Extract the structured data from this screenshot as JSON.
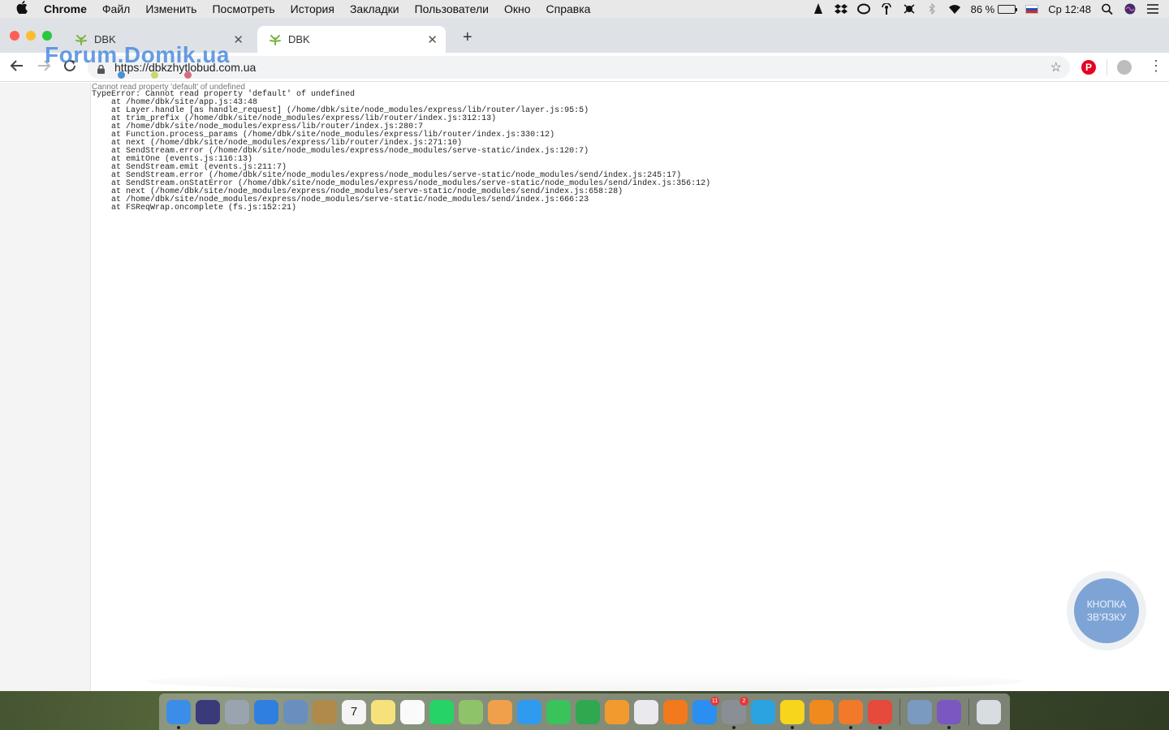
{
  "menubar": {
    "app_name": "Chrome",
    "items": [
      "Файл",
      "Изменить",
      "Посмотреть",
      "История",
      "Закладки",
      "Пользователи",
      "Окно",
      "Справка"
    ],
    "battery_percent": "86 %",
    "battery_level": 0.86,
    "clock": "Ср 12:48"
  },
  "browser": {
    "tabs": [
      {
        "title": "DBK",
        "active": false
      },
      {
        "title": "DBK",
        "active": true
      }
    ],
    "url": "https://dbkzhytlobud.com.ua",
    "watermark": "Forum.Domik.ua"
  },
  "page": {
    "error_heading": "Cannot read property 'default' of undefined",
    "stack_lines": [
      "TypeError: Cannot read property 'default' of undefined",
      "    at /home/dbk/site/app.js:43:48",
      "    at Layer.handle [as handle_request] (/home/dbk/site/node_modules/express/lib/router/layer.js:95:5)",
      "    at trim_prefix (/home/dbk/site/node_modules/express/lib/router/index.js:312:13)",
      "    at /home/dbk/site/node_modules/express/lib/router/index.js:280:7",
      "    at Function.process_params (/home/dbk/site/node_modules/express/lib/router/index.js:330:12)",
      "    at next (/home/dbk/site/node_modules/express/lib/router/index.js:271:10)",
      "    at SendStream.error (/home/dbk/site/node_modules/express/node_modules/serve-static/index.js:120:7)",
      "    at emitOne (events.js:116:13)",
      "    at SendStream.emit (events.js:211:7)",
      "    at SendStream.error (/home/dbk/site/node_modules/express/node_modules/serve-static/node_modules/send/index.js:245:17)",
      "    at SendStream.onStatError (/home/dbk/site/node_modules/express/node_modules/serve-static/node_modules/send/index.js:356:12)",
      "    at next (/home/dbk/site/node_modules/express/node_modules/serve-static/node_modules/send/index.js:658:28)",
      "    at /home/dbk/site/node_modules/express/node_modules/serve-static/node_modules/send/index.js:666:23",
      "    at FSReqWrap.oncomplete (fs.js:152:21)"
    ],
    "contact_button": {
      "line1": "КНОПКА",
      "line2": "ЗВ'ЯЗКУ"
    }
  },
  "dock": {
    "apps": [
      {
        "name": "finder-icon",
        "color": "#3b8ee8",
        "running": true
      },
      {
        "name": "siri-icon",
        "color": "#3a3a7a",
        "running": false
      },
      {
        "name": "launchpad-icon",
        "color": "#9aa4b0",
        "running": false
      },
      {
        "name": "safari-icon",
        "color": "#2f7fe0",
        "running": false
      },
      {
        "name": "preview-icon",
        "color": "#6a8fbf",
        "running": false
      },
      {
        "name": "notebook-icon",
        "color": "#b08a4a",
        "running": false
      },
      {
        "name": "calendar-icon",
        "color": "#f4f4f4",
        "running": false,
        "label": "7"
      },
      {
        "name": "notes-icon",
        "color": "#f6e27a",
        "running": false
      },
      {
        "name": "reminders-icon",
        "color": "#fafafa",
        "running": false
      },
      {
        "name": "whatsapp-icon",
        "color": "#25d366",
        "running": false
      },
      {
        "name": "maps-icon",
        "color": "#8fc36a",
        "running": false
      },
      {
        "name": "photos-icon",
        "color": "#f0a04b",
        "running": false
      },
      {
        "name": "messages-icon",
        "color": "#2e9bf0",
        "running": false
      },
      {
        "name": "facetime-icon",
        "color": "#3ac25b",
        "running": false
      },
      {
        "name": "numbers-icon",
        "color": "#2fa84f",
        "running": false
      },
      {
        "name": "pages-icon",
        "color": "#f29a2e",
        "running": false
      },
      {
        "name": "itunes-icon",
        "color": "#e9e9ee",
        "running": false
      },
      {
        "name": "books-icon",
        "color": "#f27a1c",
        "running": false
      },
      {
        "name": "app-store-icon",
        "color": "#2a8ff0",
        "running": false,
        "badge": "11"
      },
      {
        "name": "system-preferences-icon",
        "color": "#8a8f96",
        "running": true,
        "badge": "2"
      },
      {
        "name": "telegram-icon",
        "color": "#2aa3e0",
        "running": false
      },
      {
        "name": "smiley-app-icon",
        "color": "#f6d51c",
        "running": true
      },
      {
        "name": "vlc-icon",
        "color": "#f08a1e",
        "running": false
      },
      {
        "name": "vpn-icon",
        "color": "#f07a2a",
        "running": true
      },
      {
        "name": "chrome-icon",
        "color": "#e64a3b",
        "running": true
      },
      {
        "name": "image-capture-icon",
        "color": "#7a9ac0",
        "running": false
      },
      {
        "name": "viber-icon",
        "color": "#7b57c2",
        "running": true
      },
      {
        "name": "trash-icon",
        "color": "#d8dde2",
        "running": false
      }
    ]
  }
}
